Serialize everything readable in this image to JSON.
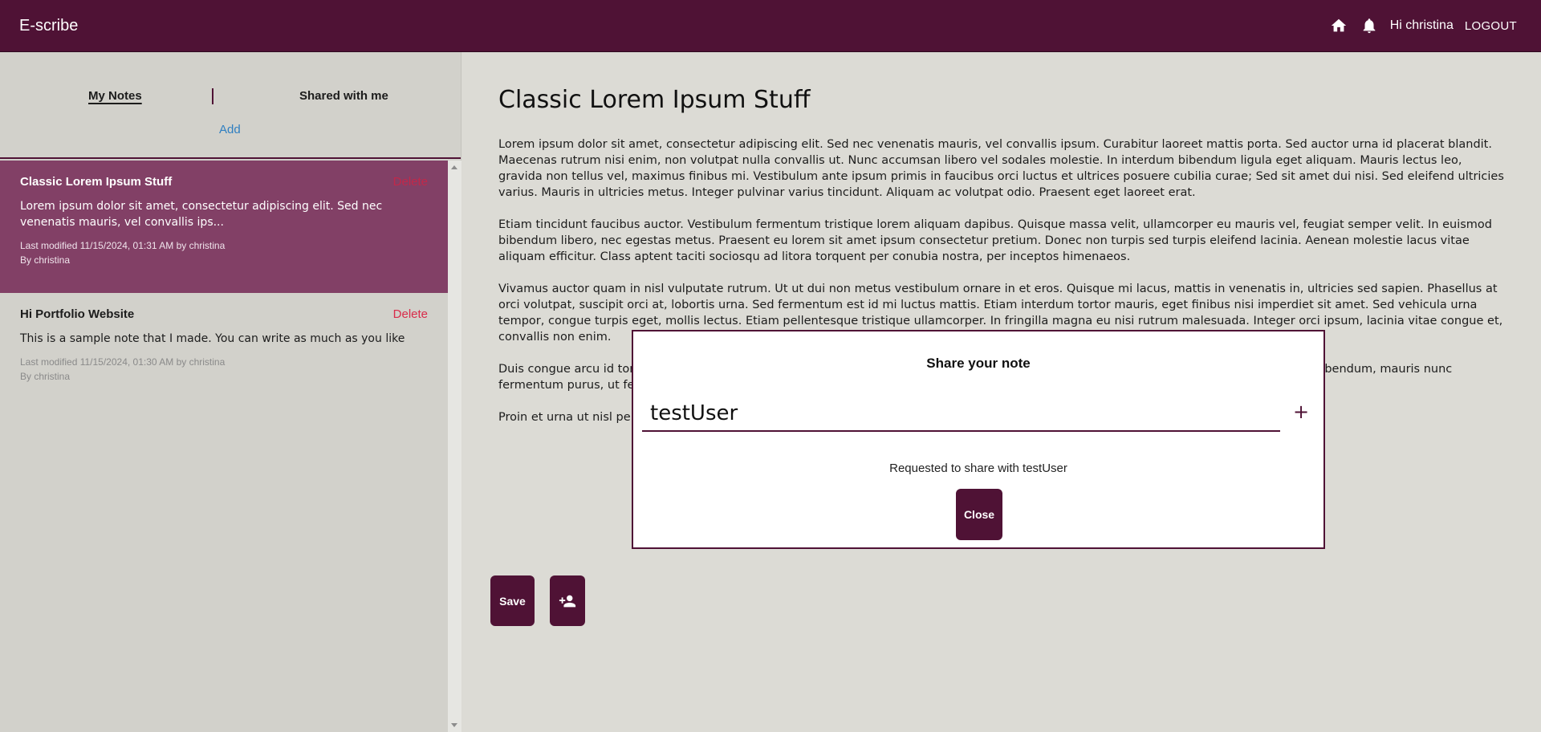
{
  "colors": {
    "brand": "#4f1235",
    "active_note": "#824066",
    "delete": "#d92b4a",
    "link": "#2f7fc1",
    "background": "#dcdbd5"
  },
  "header": {
    "brand": "E-scribe",
    "home_icon": "home-icon",
    "bell_icon": "bell-icon",
    "greeting": "Hi christina",
    "logout": "LOGOUT"
  },
  "sidebar": {
    "tabs": {
      "my_notes": "My Notes",
      "shared": "Shared with me"
    },
    "add": "Add",
    "notes": [
      {
        "title": "Classic Lorem Ipsum Stuff",
        "delete": "Delete",
        "preview": "Lorem ipsum dolor sit amet, consectetur adipiscing elit. Sed nec venenatis mauris, vel convallis ips...",
        "modified": "Last modified 11/15/2024, 01:31 AM by christina",
        "author": "By christina"
      },
      {
        "title": "Hi Portfolio Website",
        "delete": "Delete",
        "preview": "This is a sample note that I made. You can write as much as you like",
        "modified": "Last modified 11/15/2024, 01:30 AM by christina",
        "author": "By christina"
      }
    ]
  },
  "editor": {
    "title": "Classic Lorem Ipsum Stuff",
    "paragraphs": [
      "Lorem ipsum dolor sit amet, consectetur adipiscing elit. Sed nec venenatis mauris, vel convallis ipsum. Curabitur laoreet mattis porta. Sed auctor urna id placerat blandit. Maecenas rutrum nisi enim, non volutpat nulla convallis ut. Nunc accumsan libero vel sodales molestie. In interdum bibendum ligula eget aliquam. Mauris lectus leo, gravida non tellus vel, maximus finibus mi. Vestibulum ante ipsum primis in faucibus orci luctus et ultrices posuere cubilia curae; Sed sit amet dui nisi. Sed eleifend ultricies varius. Mauris in ultricies metus. Integer pulvinar varius tincidunt. Aliquam ac volutpat odio. Praesent eget laoreet erat.",
      "Etiam tincidunt faucibus auctor. Vestibulum fermentum tristique lorem aliquam dapibus. Quisque massa velit, ullamcorper eu mauris vel, feugiat semper velit. In euismod bibendum libero, nec egestas metus. Praesent eu lorem sit amet ipsum consectetur pretium. Donec non turpis sed turpis eleifend lacinia. Aenean molestie lacus vitae aliquam efficitur. Class aptent taciti sociosqu ad litora torquent per conubia nostra, per inceptos himenaeos.",
      "Vivamus auctor quam in nisl vulputate rutrum. Ut ut dui non metus vestibulum ornare in et eros. Quisque mi lacus, mattis in venenatis in, ultricies sed sapien. Phasellus at orci volutpat, suscipit orci at, lobortis urna. Sed fermentum est id mi luctus mattis. Etiam interdum tortor mauris, eget finibus nisi imperdiet sit amet. Sed vehicula urna tempor, congue turpis eget, mollis lectus. Etiam pellentesque tristique ullamcorper. In fringilla magna eu nisi rutrum malesuada. Integer orci ipsum, lacinia vitae congue et, convallis non enim.",
      "Duis congue arcu id tortor ... do fermentum. Proin nulla quam, tristique sit amet ... egestas vitae, lacinia eu nulla. Aliquam vitae dolor ac ... bibendum, mauris nunc fermentum purus, ut fe... ut vehicula felis. Sed eget sem vehicula, luctus lacus u...",
      "Proin et urna ut nisl pel... mmodo pretium. Cras blandit sapien quis risus placer... ac sit amet odio. Integer non varius tortor. Ut ac cons..."
    ],
    "save": "Save",
    "share_icon": "person-add-icon"
  },
  "modal": {
    "title": "Share your note",
    "input_value": "testUser",
    "plus": "+",
    "status": "Requested to share with testUser",
    "close": "Close"
  }
}
